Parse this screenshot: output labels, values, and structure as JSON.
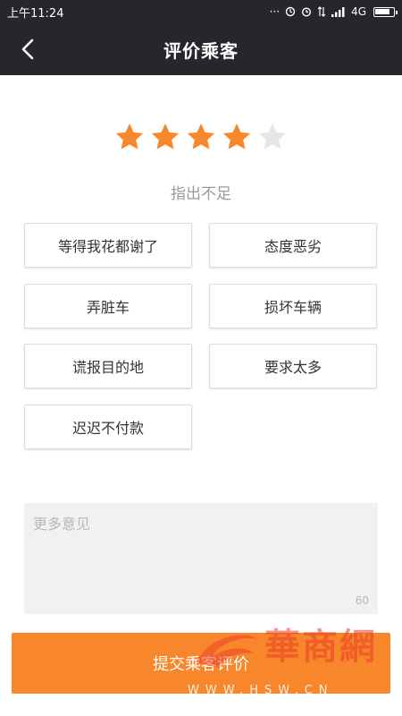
{
  "status_bar": {
    "time": "上午11:24",
    "network": "4G",
    "dots": "···",
    "battery_level": 0.85
  },
  "header": {
    "title": "评价乘客",
    "back_icon": "chevron-left-icon"
  },
  "rating": {
    "value": 4,
    "max": 5,
    "active_color": "#f7872a",
    "inactive_color": "#e4e6ea"
  },
  "section_label": "指出不足",
  "tags": [
    "等得我花都谢了",
    "态度恶劣",
    "弄脏车",
    "损坏车辆",
    "谎报目的地",
    "要求太多",
    "迟迟不付款"
  ],
  "comment": {
    "placeholder": "更多意见",
    "char_limit": "60"
  },
  "submit": {
    "label": "提交乘客评价",
    "color": "#f7872a"
  },
  "watermark": {
    "brand": "華商網",
    "url": "WWW.HSW.CN"
  }
}
